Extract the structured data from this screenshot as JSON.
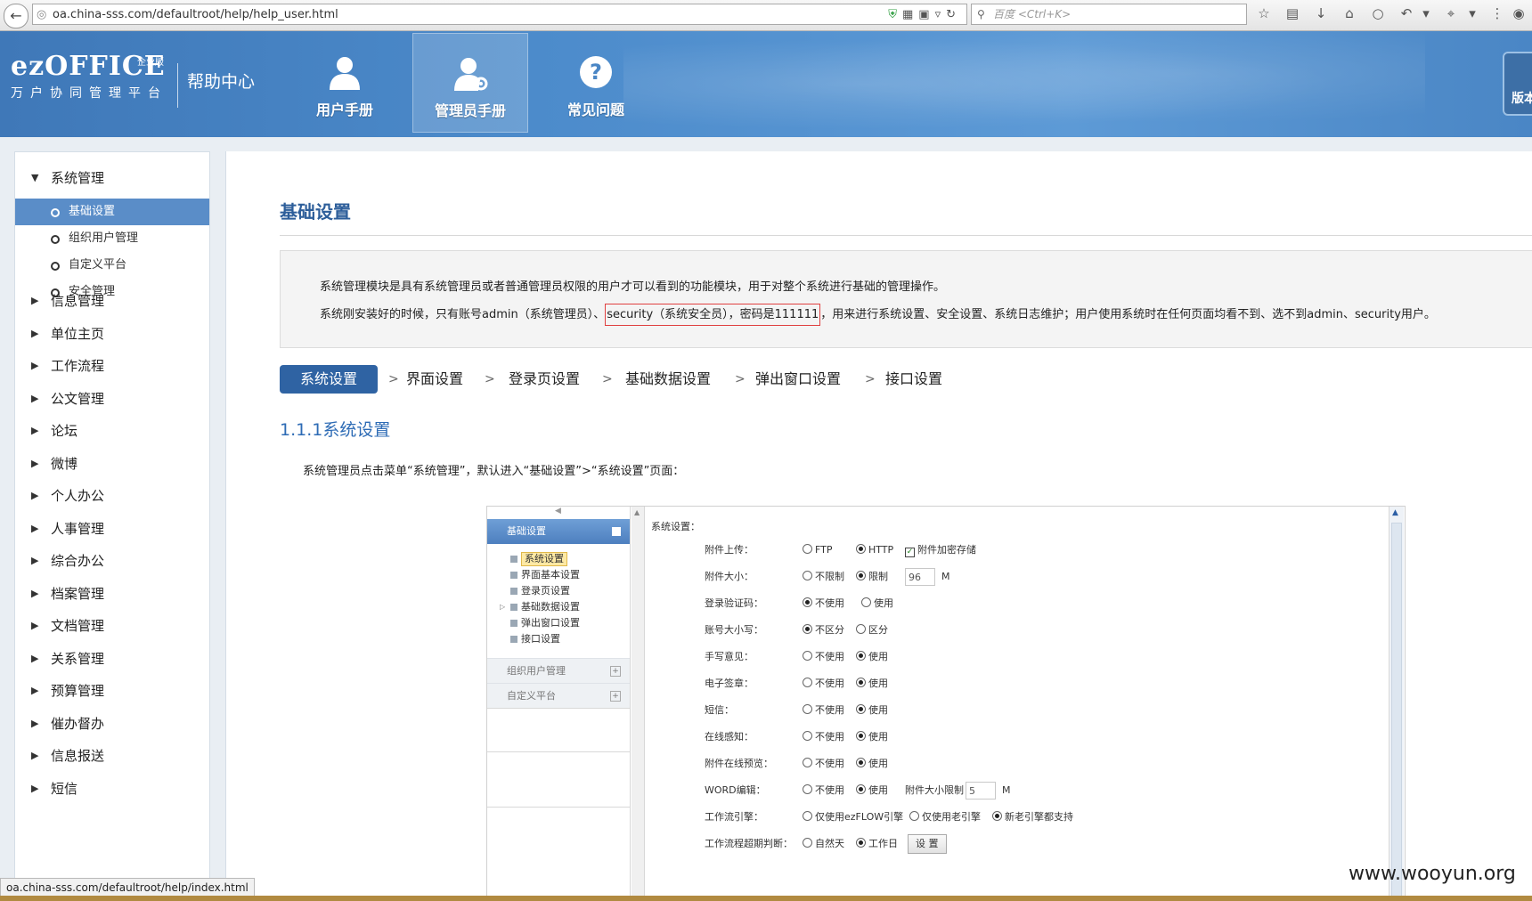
{
  "browser": {
    "url": "oa.china-sss.com/defaultroot/help/help_user.html",
    "search_placeholder": "百度 <Ctrl+K>",
    "status_url": "oa.china-sss.com/defaultroot/help/index.html"
  },
  "header": {
    "logo_text": "ezOFFICE",
    "logo_edition": "企业版",
    "logo_subtitle": "万户协同管理平台",
    "help_center": "帮助中心",
    "tabs": [
      {
        "label": "用户手册"
      },
      {
        "label": "管理员手册"
      },
      {
        "label": "常见问题"
      }
    ],
    "version_label": "版本"
  },
  "sidebar": {
    "open_group": "系统管理",
    "sub_items": [
      "基础设置",
      "组织用户管理",
      "自定义平台",
      "安全管理"
    ],
    "groups": [
      "信息管理",
      "单位主页",
      "工作流程",
      "公文管理",
      "论坛",
      "微博",
      "个人办公",
      "人事管理",
      "综合办公",
      "档案管理",
      "文档管理",
      "关系管理",
      "预算管理",
      "催办督办",
      "信息报送",
      "短信"
    ]
  },
  "main": {
    "title": "基础设置",
    "intro_line1": "系统管理模块是具有系统管理员或者普通管理员权限的用户才可以看到的功能模块，用于对整个系统进行基础的管理操作。",
    "intro_line2_pre": "系统刚安装好的时候，只有账号admin（系统管理员）、",
    "intro_line2_highlight": "security（系统安全员），密码是111111",
    "intro_line2_post": "，用来进行系统设置、安全设置、系统日志维护；用户使用系统时在任何页面均看不到、选不到admin、security用户。",
    "steps": [
      "系统设置",
      "界面设置",
      "登录页设置",
      "基础数据设置",
      "弹出窗口设置",
      "接口设置"
    ],
    "step_separator": ">",
    "section_heading": "1.1.1系统设置",
    "section_text": "系统管理员点击菜单“系统管理”，默认进入“基础设置”>“系统设置”页面："
  },
  "screenshot": {
    "left_head": "基础设置",
    "tree": [
      "系统设置",
      "界面基本设置",
      "登录页设置",
      "基础数据设置",
      "弹出窗口设置",
      "接口设置"
    ],
    "collapsed": [
      "组织用户管理",
      "自定义平台"
    ],
    "legend": "系统设置：",
    "rows": [
      {
        "label": "附件上传：",
        "opts": [
          "FTP",
          "HTTP"
        ],
        "extra_check": "附件加密存储"
      },
      {
        "label": "附件大小：",
        "opts": [
          "不限制",
          "限制"
        ],
        "input": "96",
        "unit": "M"
      },
      {
        "label": "登录验证码：",
        "opts": [
          "不使用",
          "使用"
        ]
      },
      {
        "label": "账号大小写：",
        "opts": [
          "不区分",
          "区分"
        ]
      },
      {
        "label": "手写意见：",
        "opts": [
          "不使用",
          "使用"
        ]
      },
      {
        "label": "电子签章：",
        "opts": [
          "不使用",
          "使用"
        ]
      },
      {
        "label": "短信：",
        "opts": [
          "不使用",
          "使用"
        ]
      },
      {
        "label": "在线感知：",
        "opts": [
          "不使用",
          "使用"
        ]
      },
      {
        "label": "附件在线预览：",
        "opts": [
          "不使用",
          "使用"
        ]
      },
      {
        "label": "WORD编辑：",
        "opts": [
          "不使用",
          "使用"
        ],
        "size_label": "附件大小限制",
        "input": "5",
        "unit": "M"
      },
      {
        "label": "工作流引擎：",
        "opts": [
          "仅使用ezFLOW引擎",
          "仅使用老引擎",
          "新老引擎都支持"
        ]
      },
      {
        "label": "工作流程超期判断：",
        "opts": [
          "自然天",
          "工作日"
        ],
        "button": "设 置"
      }
    ]
  },
  "watermark": "www.wooyun.org"
}
